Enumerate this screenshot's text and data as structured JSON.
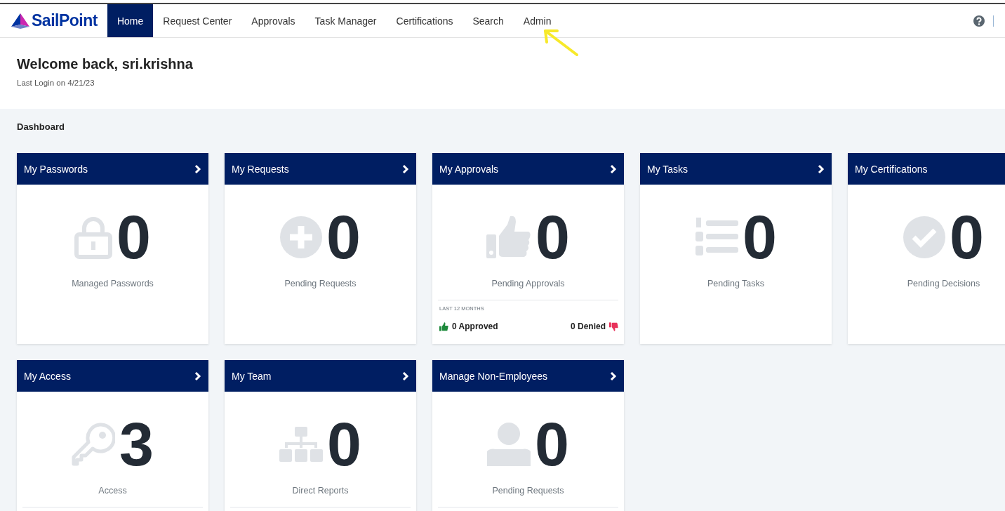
{
  "navbar": {
    "logo": "SailPoint",
    "tabs": [
      {
        "label": "Home",
        "selected": true
      },
      {
        "label": "Request Center",
        "selected": false
      },
      {
        "label": "Approvals",
        "selected": false
      },
      {
        "label": "Task Manager",
        "selected": false
      },
      {
        "label": "Certifications",
        "selected": false
      },
      {
        "label": "Search",
        "selected": false
      },
      {
        "label": "Admin",
        "selected": false
      }
    ]
  },
  "welcome": {
    "title": "Welcome back, sri.krishna",
    "last_login": "Last Login on 4/21/23"
  },
  "dashboard": {
    "title": "Dashboard",
    "cards": [
      {
        "title": "My Passwords",
        "kind": "lock",
        "count": "0",
        "label": "Managed Passwords",
        "arrow": true,
        "divider": false
      },
      {
        "title": "My Requests",
        "kind": "plus",
        "count": "0",
        "label": "Pending Requests",
        "arrow": true,
        "divider": false
      },
      {
        "title": "My Approvals",
        "kind": "thumb",
        "count": "0",
        "label": "Pending Approvals",
        "arrow": true,
        "divider": true,
        "footer": {
          "period": "LAST 12 MONTHS",
          "approved": "0 Approved",
          "denied": "0 Denied"
        }
      },
      {
        "title": "My Tasks",
        "kind": "list",
        "count": "0",
        "label": "Pending Tasks",
        "arrow": true,
        "divider": false
      },
      {
        "title": "My Certifications",
        "kind": "check",
        "count": "0",
        "label": "Pending Decisions",
        "arrow": false,
        "divider": false
      },
      {
        "title": "My Access",
        "kind": "key",
        "count": "3",
        "label": "Access",
        "arrow": true,
        "divider": true
      },
      {
        "title": "My Team",
        "kind": "org",
        "count": "0",
        "label": "Direct Reports",
        "arrow": true,
        "divider": true
      },
      {
        "title": "Manage Non-Employees",
        "kind": "user",
        "count": "0",
        "label": "Pending Requests",
        "arrow": true,
        "divider": true
      }
    ]
  },
  "annotations": [
    {
      "kind": "arrow"
    }
  ]
}
